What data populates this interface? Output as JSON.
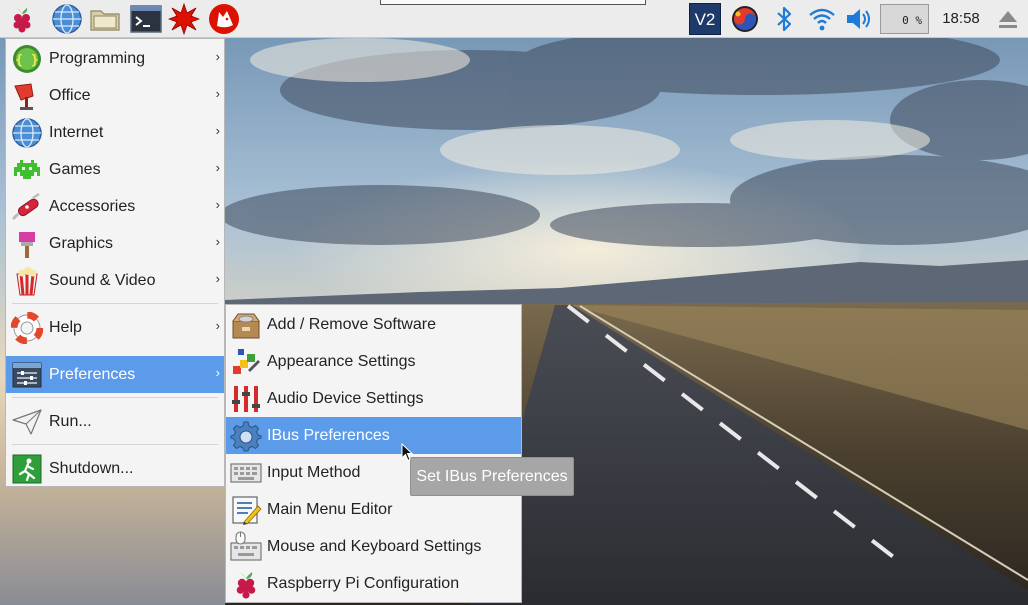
{
  "taskbar": {
    "launchers": [
      {
        "name": "raspberry-menu",
        "icon": "raspberry-icon"
      },
      {
        "name": "web-browser",
        "icon": "globe-icon"
      },
      {
        "name": "file-manager",
        "icon": "folder-icon"
      },
      {
        "name": "terminal",
        "icon": "terminal-icon"
      },
      {
        "name": "mathematica",
        "icon": "spikey-icon"
      },
      {
        "name": "wolfram",
        "icon": "wolf-icon"
      }
    ],
    "tray": {
      "vnc_label": "V2",
      "cpu_usage": "0 %",
      "clock": "18:58"
    }
  },
  "main_menu": {
    "items": [
      {
        "label": "Programming",
        "icon": "programming-icon",
        "has_submenu": true
      },
      {
        "label": "Office",
        "icon": "office-icon",
        "has_submenu": true
      },
      {
        "label": "Internet",
        "icon": "globe-icon",
        "has_submenu": true
      },
      {
        "label": "Games",
        "icon": "space-invader-icon",
        "has_submenu": true
      },
      {
        "label": "Accessories",
        "icon": "swiss-knife-icon",
        "has_submenu": true
      },
      {
        "label": "Graphics",
        "icon": "paint-brush-icon",
        "has_submenu": true
      },
      {
        "label": "Sound & Video",
        "icon": "popcorn-icon",
        "has_submenu": true
      },
      {
        "label": "Help",
        "icon": "lifebuoy-icon",
        "has_submenu": true
      },
      {
        "label": "Preferences",
        "icon": "preferences-icon",
        "has_submenu": true,
        "active": true
      },
      {
        "label": "Run...",
        "icon": "paper-plane-icon",
        "has_submenu": false
      },
      {
        "label": "Shutdown...",
        "icon": "exit-icon",
        "has_submenu": false
      }
    ],
    "submenu_arrow": "›"
  },
  "preferences_submenu": {
    "items": [
      {
        "label": "Add / Remove Software",
        "icon": "package-icon"
      },
      {
        "label": "Appearance Settings",
        "icon": "palette-icon"
      },
      {
        "label": "Audio Device Settings",
        "icon": "mixer-icon"
      },
      {
        "label": "IBus Preferences",
        "icon": "gear-icon",
        "active": true
      },
      {
        "label": "Input Method",
        "icon": "keyboard-icon"
      },
      {
        "label": "Main Menu Editor",
        "icon": "menu-editor-icon"
      },
      {
        "label": "Mouse and Keyboard Settings",
        "icon": "mouse-keyboard-icon"
      },
      {
        "label": "Raspberry Pi Configuration",
        "icon": "raspberry-icon"
      }
    ]
  },
  "tooltip": {
    "text": "Set IBus Preferences"
  },
  "colors": {
    "menu_highlight": "#5b9bea",
    "taskbar_bg": "#ececec",
    "menu_bg": "#f4f4f4",
    "tooltip_bg": "#a6a6a6"
  }
}
